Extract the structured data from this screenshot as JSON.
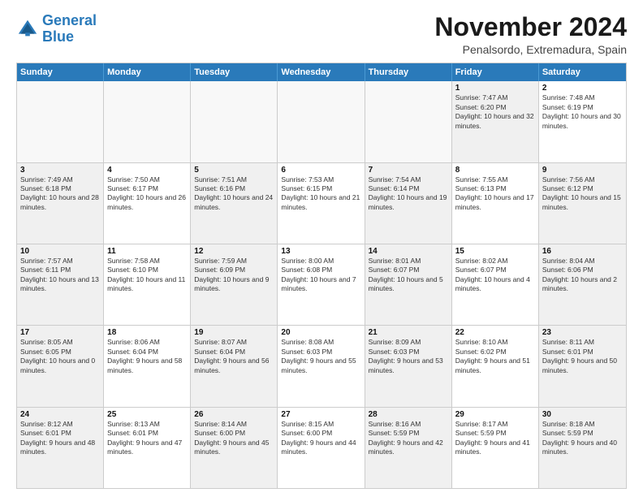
{
  "header": {
    "logo_line1": "General",
    "logo_line2": "Blue",
    "month_title": "November 2024",
    "location": "Penalsordo, Extremadura, Spain"
  },
  "days_of_week": [
    "Sunday",
    "Monday",
    "Tuesday",
    "Wednesday",
    "Thursday",
    "Friday",
    "Saturday"
  ],
  "rows": [
    [
      {
        "day": "",
        "text": "",
        "empty": true
      },
      {
        "day": "",
        "text": "",
        "empty": true
      },
      {
        "day": "",
        "text": "",
        "empty": true
      },
      {
        "day": "",
        "text": "",
        "empty": true
      },
      {
        "day": "",
        "text": "",
        "empty": true
      },
      {
        "day": "1",
        "text": "Sunrise: 7:47 AM\nSunset: 6:20 PM\nDaylight: 10 hours and 32 minutes.",
        "shaded": true
      },
      {
        "day": "2",
        "text": "Sunrise: 7:48 AM\nSunset: 6:19 PM\nDaylight: 10 hours and 30 minutes.",
        "shaded": false
      }
    ],
    [
      {
        "day": "3",
        "text": "Sunrise: 7:49 AM\nSunset: 6:18 PM\nDaylight: 10 hours and 28 minutes.",
        "shaded": true
      },
      {
        "day": "4",
        "text": "Sunrise: 7:50 AM\nSunset: 6:17 PM\nDaylight: 10 hours and 26 minutes.",
        "shaded": false
      },
      {
        "day": "5",
        "text": "Sunrise: 7:51 AM\nSunset: 6:16 PM\nDaylight: 10 hours and 24 minutes.",
        "shaded": true
      },
      {
        "day": "6",
        "text": "Sunrise: 7:53 AM\nSunset: 6:15 PM\nDaylight: 10 hours and 21 minutes.",
        "shaded": false
      },
      {
        "day": "7",
        "text": "Sunrise: 7:54 AM\nSunset: 6:14 PM\nDaylight: 10 hours and 19 minutes.",
        "shaded": true
      },
      {
        "day": "8",
        "text": "Sunrise: 7:55 AM\nSunset: 6:13 PM\nDaylight: 10 hours and 17 minutes.",
        "shaded": false
      },
      {
        "day": "9",
        "text": "Sunrise: 7:56 AM\nSunset: 6:12 PM\nDaylight: 10 hours and 15 minutes.",
        "shaded": true
      }
    ],
    [
      {
        "day": "10",
        "text": "Sunrise: 7:57 AM\nSunset: 6:11 PM\nDaylight: 10 hours and 13 minutes.",
        "shaded": true
      },
      {
        "day": "11",
        "text": "Sunrise: 7:58 AM\nSunset: 6:10 PM\nDaylight: 10 hours and 11 minutes.",
        "shaded": false
      },
      {
        "day": "12",
        "text": "Sunrise: 7:59 AM\nSunset: 6:09 PM\nDaylight: 10 hours and 9 minutes.",
        "shaded": true
      },
      {
        "day": "13",
        "text": "Sunrise: 8:00 AM\nSunset: 6:08 PM\nDaylight: 10 hours and 7 minutes.",
        "shaded": false
      },
      {
        "day": "14",
        "text": "Sunrise: 8:01 AM\nSunset: 6:07 PM\nDaylight: 10 hours and 5 minutes.",
        "shaded": true
      },
      {
        "day": "15",
        "text": "Sunrise: 8:02 AM\nSunset: 6:07 PM\nDaylight: 10 hours and 4 minutes.",
        "shaded": false
      },
      {
        "day": "16",
        "text": "Sunrise: 8:04 AM\nSunset: 6:06 PM\nDaylight: 10 hours and 2 minutes.",
        "shaded": true
      }
    ],
    [
      {
        "day": "17",
        "text": "Sunrise: 8:05 AM\nSunset: 6:05 PM\nDaylight: 10 hours and 0 minutes.",
        "shaded": true
      },
      {
        "day": "18",
        "text": "Sunrise: 8:06 AM\nSunset: 6:04 PM\nDaylight: 9 hours and 58 minutes.",
        "shaded": false
      },
      {
        "day": "19",
        "text": "Sunrise: 8:07 AM\nSunset: 6:04 PM\nDaylight: 9 hours and 56 minutes.",
        "shaded": true
      },
      {
        "day": "20",
        "text": "Sunrise: 8:08 AM\nSunset: 6:03 PM\nDaylight: 9 hours and 55 minutes.",
        "shaded": false
      },
      {
        "day": "21",
        "text": "Sunrise: 8:09 AM\nSunset: 6:03 PM\nDaylight: 9 hours and 53 minutes.",
        "shaded": true
      },
      {
        "day": "22",
        "text": "Sunrise: 8:10 AM\nSunset: 6:02 PM\nDaylight: 9 hours and 51 minutes.",
        "shaded": false
      },
      {
        "day": "23",
        "text": "Sunrise: 8:11 AM\nSunset: 6:01 PM\nDaylight: 9 hours and 50 minutes.",
        "shaded": true
      }
    ],
    [
      {
        "day": "24",
        "text": "Sunrise: 8:12 AM\nSunset: 6:01 PM\nDaylight: 9 hours and 48 minutes.",
        "shaded": true
      },
      {
        "day": "25",
        "text": "Sunrise: 8:13 AM\nSunset: 6:01 PM\nDaylight: 9 hours and 47 minutes.",
        "shaded": false
      },
      {
        "day": "26",
        "text": "Sunrise: 8:14 AM\nSunset: 6:00 PM\nDaylight: 9 hours and 45 minutes.",
        "shaded": true
      },
      {
        "day": "27",
        "text": "Sunrise: 8:15 AM\nSunset: 6:00 PM\nDaylight: 9 hours and 44 minutes.",
        "shaded": false
      },
      {
        "day": "28",
        "text": "Sunrise: 8:16 AM\nSunset: 5:59 PM\nDaylight: 9 hours and 42 minutes.",
        "shaded": true
      },
      {
        "day": "29",
        "text": "Sunrise: 8:17 AM\nSunset: 5:59 PM\nDaylight: 9 hours and 41 minutes.",
        "shaded": false
      },
      {
        "day": "30",
        "text": "Sunrise: 8:18 AM\nSunset: 5:59 PM\nDaylight: 9 hours and 40 minutes.",
        "shaded": true
      }
    ]
  ]
}
